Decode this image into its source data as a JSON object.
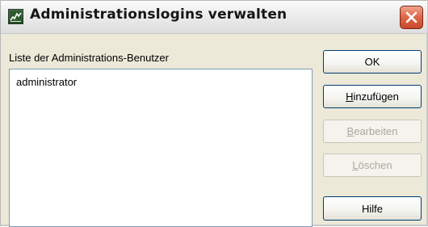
{
  "window": {
    "title": "Administrationslogins verwalten"
  },
  "list": {
    "label": "Liste der Administrations-Benutzer",
    "items": [
      "administrator"
    ]
  },
  "buttons": {
    "ok": {
      "label": "OK",
      "enabled": true
    },
    "add": {
      "label_mnemonic": "H",
      "label_rest": "inzufügen",
      "enabled": true
    },
    "edit": {
      "label_mnemonic": "B",
      "label_rest": "earbeiten",
      "enabled": false
    },
    "delete": {
      "label_mnemonic": "L",
      "label_rest": "öschen",
      "enabled": false
    },
    "help": {
      "label": "Hilfe",
      "enabled": true
    }
  },
  "icons": {
    "app": "app-chart-icon",
    "close": "close-icon"
  },
  "colors": {
    "close_button": "#e06a4c",
    "listbox_border": "#7f9db9",
    "button_border": "#003c74",
    "disabled_text": "#aca899"
  }
}
